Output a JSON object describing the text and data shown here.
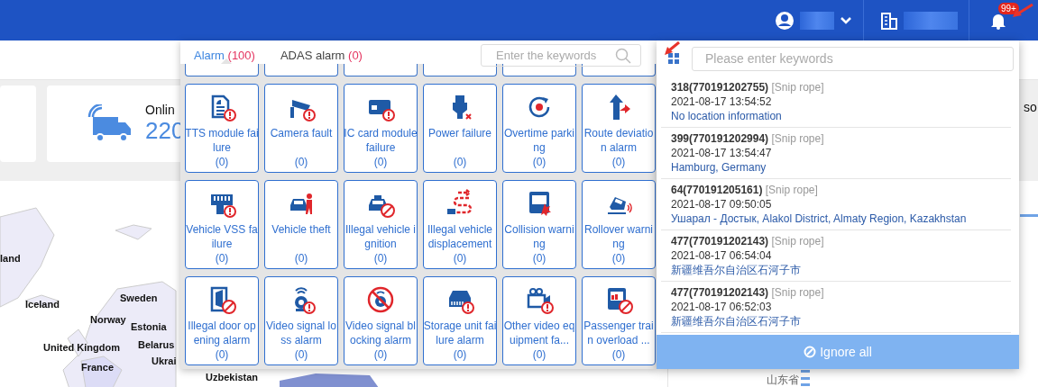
{
  "header": {
    "badge": "99+"
  },
  "stats": [
    {
      "label": "Onlin",
      "value": "220"
    }
  ],
  "side_label": "so",
  "map": {
    "labels": [
      "land",
      "Iceland",
      "Sweden",
      "Norway",
      "Estonia",
      "United Kingdom",
      "Belarus",
      "France",
      "Ukrai",
      "Uzbekistan"
    ]
  },
  "province_label": "山东省",
  "alarm_panel": {
    "tabs": [
      {
        "label": "Alarm",
        "count": "(100)",
        "selected": true
      },
      {
        "label": "ADAS alarm",
        "count": "(0)",
        "selected": false
      }
    ],
    "search": {
      "placeholder": "Enter the keywords"
    },
    "alarm_types": [
      {
        "name": "TTS module failure",
        "count": "(0)"
      },
      {
        "name": "Camera fault",
        "count": "(0)"
      },
      {
        "name": "IC card module failure",
        "count": "(0)"
      },
      {
        "name": "Power failure",
        "count": "(0)"
      },
      {
        "name": "Overtime parking",
        "count": "(0)"
      },
      {
        "name": "Route deviation alarm",
        "count": "(0)"
      },
      {
        "name": "Vehicle VSS failure",
        "count": "(0)"
      },
      {
        "name": "Vehicle theft",
        "count": "(0)"
      },
      {
        "name": "Illegal vehicle ignition",
        "count": "(0)"
      },
      {
        "name": "Illegal vehicle displacement",
        "count": "(0)"
      },
      {
        "name": "Collision warning",
        "count": "(0)"
      },
      {
        "name": "Rollover warning",
        "count": "(0)"
      },
      {
        "name": "Illegal door opening alarm",
        "count": "(0)"
      },
      {
        "name": "Video signal loss alarm",
        "count": "(0)"
      },
      {
        "name": "Video signal blocking alarm",
        "count": "(0)"
      },
      {
        "name": "Storage unit failure alarm",
        "count": "(0)"
      },
      {
        "name": "Other video equipment fa...",
        "count": "(0)"
      },
      {
        "name": "Passenger train overload ...",
        "count": "(0)"
      }
    ]
  },
  "notifications": {
    "search": {
      "placeholder": "Please enter keywords"
    },
    "items": [
      {
        "vehicle": "318(770191202755)",
        "type": "[Snip rope]",
        "time": "2021-08-17 13:54:52",
        "location": "No location information"
      },
      {
        "vehicle": "399(770191202994)",
        "type": "[Snip rope]",
        "time": "2021-08-17 13:54:47",
        "location": "Hamburg, Germany"
      },
      {
        "vehicle": "64(770191205161)",
        "type": "[Snip rope]",
        "time": "2021-08-17 09:50:05",
        "location": "Ушарал - Достык, Alakol District, Almaty Region, Kazakhstan"
      },
      {
        "vehicle": "477(770191202143)",
        "type": "[Snip rope]",
        "time": "2021-08-17 06:54:04",
        "location": "新疆维吾尔自治区石河子市"
      },
      {
        "vehicle": "477(770191202143)",
        "type": "[Snip rope]",
        "time": "2021-08-17 06:52:03",
        "location": "新疆维吾尔自治区石河子市"
      }
    ],
    "ignore_button": "Ignore all"
  }
}
